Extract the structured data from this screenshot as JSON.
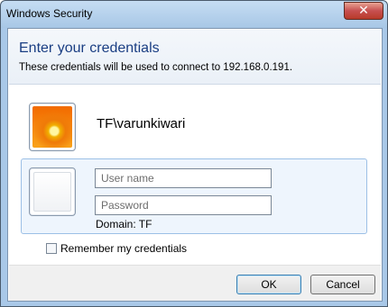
{
  "window": {
    "title": "Windows Security",
    "close_glyph": "✕"
  },
  "header": {
    "title": "Enter your credentials",
    "subtitle": "These credentials will be used to connect to 192.168.0.191."
  },
  "saved_user": {
    "label": "TF\\varunkiwari",
    "icon": "user-photo-icon"
  },
  "credentials": {
    "username_placeholder": "User name",
    "password_placeholder": "Password",
    "domain_label": "Domain: TF",
    "icon": "blank-user-tile-icon"
  },
  "remember": {
    "label": "Remember my credentials",
    "checked": false
  },
  "buttons": {
    "ok": "OK",
    "cancel": "Cancel"
  },
  "colors": {
    "title_blue": "#1a3e83",
    "cred_box_bg": "#eef5fd",
    "cred_box_border": "#9cc0e6",
    "close_red": "#c75050"
  }
}
